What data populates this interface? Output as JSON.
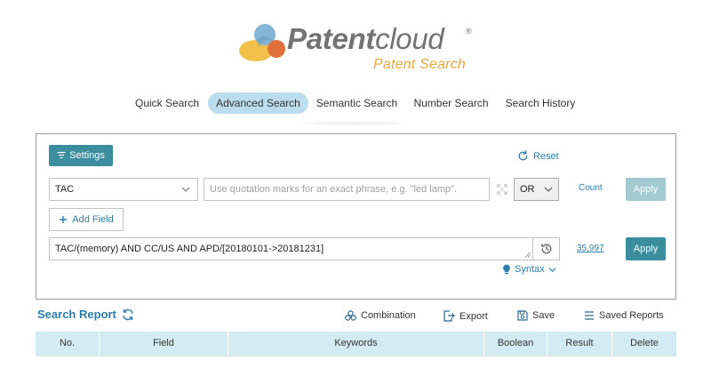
{
  "logo": {
    "brand_bold": "Patent",
    "brand_light": "cloud",
    "registered": "®",
    "subtitle": "Patent Search"
  },
  "nav": {
    "tabs": [
      {
        "label": "Quick Search",
        "active": false
      },
      {
        "label": "Advanced Search",
        "active": true
      },
      {
        "label": "Semantic Search",
        "active": false
      },
      {
        "label": "Number Search",
        "active": false
      },
      {
        "label": "Search History",
        "active": false
      }
    ]
  },
  "panel": {
    "settings_label": "Settings",
    "reset_label": "Reset",
    "field_value": "TAC",
    "keyword_placeholder": "Use quotation marks for an exact phrase, e.g. \"led lamp\".",
    "boolean_value": "OR",
    "count_label": "Count",
    "apply_label": "Apply",
    "add_field_label": "Add Field",
    "query": "TAC/(memory) AND CC/US AND APD/[20180101->20181231]",
    "result_count": "35,997",
    "syntax_label": "Syntax"
  },
  "report": {
    "title": "Search Report",
    "toolbar": {
      "combination": "Combination",
      "export": "Export",
      "save": "Save",
      "saved_reports": "Saved Reports"
    },
    "columns": [
      "No.",
      "Field",
      "Keywords",
      "Boolean",
      "Result",
      "Delete"
    ]
  },
  "colors": {
    "accent": "#3a8e9e",
    "link": "#2a7fb0",
    "tab_active": "#bcdcef",
    "table_header": "#d3ecf3",
    "logo_orange": "#e8a93e"
  },
  "icons": [
    "filter-icon",
    "reset-icon",
    "chevron-down-icon",
    "expand-icon",
    "plus-icon",
    "history-icon",
    "bulb-icon",
    "refresh-icon",
    "combination-icon",
    "export-icon",
    "save-icon",
    "list-icon"
  ]
}
